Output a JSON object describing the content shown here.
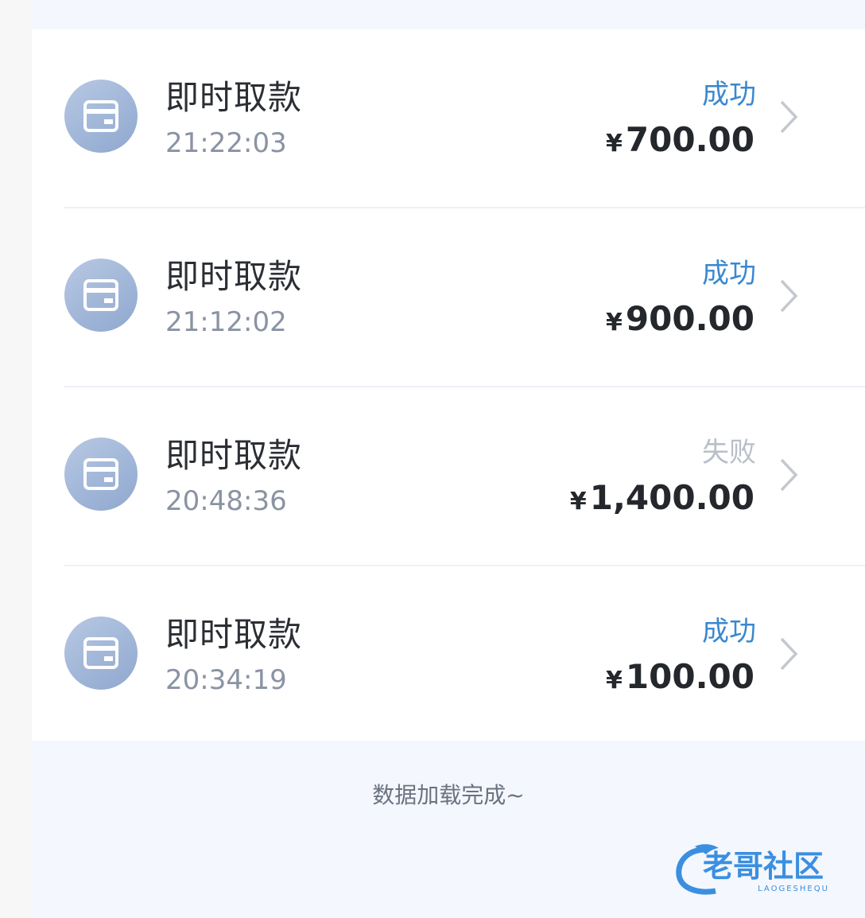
{
  "records": [
    {
      "title": "即时取款",
      "time": "21:22:03",
      "status": "成功",
      "status_type": "success",
      "currency": "¥",
      "amount": "700.00"
    },
    {
      "title": "即时取款",
      "time": "21:12:02",
      "status": "成功",
      "status_type": "success",
      "currency": "¥",
      "amount": "900.00"
    },
    {
      "title": "即时取款",
      "time": "20:48:36",
      "status": "失败",
      "status_type": "fail",
      "currency": "¥",
      "amount": "1,400.00"
    },
    {
      "title": "即时取款",
      "time": "20:34:19",
      "status": "成功",
      "status_type": "success",
      "currency": "¥",
      "amount": "100.00"
    }
  ],
  "footer": {
    "message": "数据加载完成~"
  },
  "watermark": {
    "text": "老哥社区",
    "subtext": "LAOGESHEQU"
  },
  "colors": {
    "success": "#3a88cf",
    "fail": "#b9bfc9",
    "amount": "#24272c",
    "background": "#f4f7fd"
  },
  "icons": {
    "record": "card-icon",
    "arrow": "chevron-right-icon"
  }
}
